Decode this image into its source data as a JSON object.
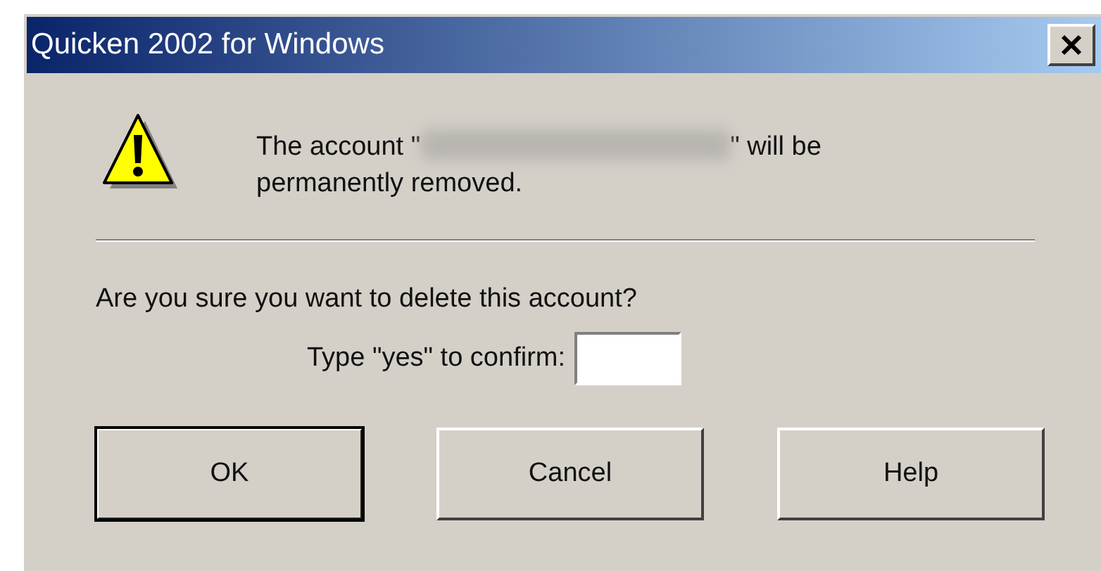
{
  "window": {
    "title": "Quicken 2002 for Windows"
  },
  "message": {
    "before": "The account \"",
    "redacted": true,
    "after": "\" will be permanently removed."
  },
  "question": "Are you sure you want to delete this account?",
  "confirm_field": {
    "label": "Type \"yes\" to confirm:"
  },
  "buttons": [
    {
      "label": "OK",
      "default": true
    },
    {
      "label": "Cancel",
      "default": false
    },
    {
      "label": "Help",
      "default": false
    }
  ]
}
